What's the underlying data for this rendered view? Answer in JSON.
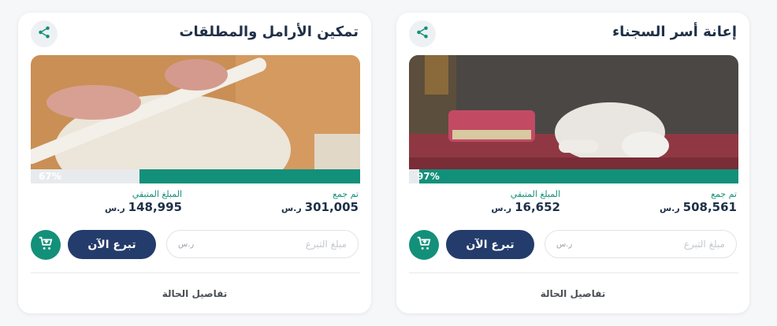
{
  "cards": [
    {
      "title": "إعانة أسر السجناء",
      "progress_label": "97%",
      "progress": 0.97,
      "collected_label": "تم جمع",
      "collected_value": "508,561",
      "remaining_label": "المبلغ المتبقي",
      "remaining_value": "16,652",
      "currency": "ر.س",
      "amount_placeholder": "مبلغ التبرع",
      "donate_label": "تبرع الآن",
      "details_label": "تفاصيل الحالة"
    },
    {
      "title": "تمكين الأرامل والمطلقات",
      "progress_label": "67%",
      "progress": 0.67,
      "collected_label": "تم جمع",
      "collected_value": "301,005",
      "remaining_label": "المبلغ المتبقي",
      "remaining_value": "148,995",
      "currency": "ر.س",
      "amount_placeholder": "مبلغ التبرع",
      "donate_label": "تبرع الآن",
      "details_label": "تفاصيل الحالة"
    }
  ],
  "icons": {
    "share": "share-icon",
    "cart": "add-to-cart-icon"
  },
  "colors": {
    "accent": "#13907a",
    "primary": "#243c6b",
    "text": "#1f3048"
  }
}
